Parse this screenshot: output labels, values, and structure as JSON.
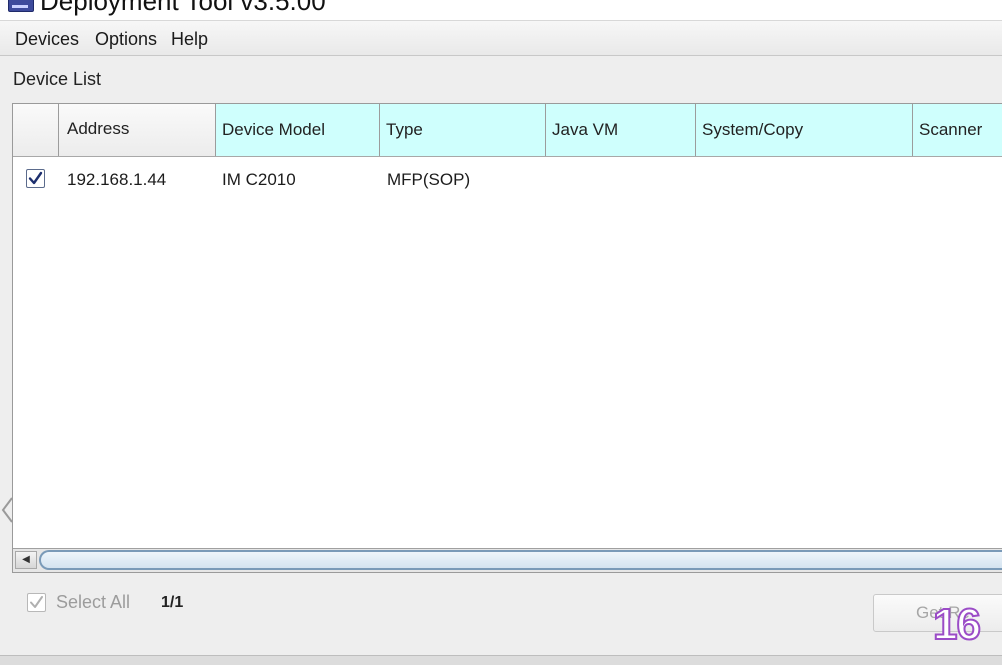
{
  "window": {
    "title": "Deployment Tool v3.5.00"
  },
  "menu": {
    "devices": "Devices",
    "options": "Options",
    "help": "Help"
  },
  "device_list": {
    "label": "Device List",
    "columns": [
      "Address",
      "Device Model",
      "Type",
      "Java VM",
      "System/Copy",
      "Scanner"
    ],
    "rows": [
      {
        "checked": true,
        "address": "192.168.1.44",
        "model": "IM C2010",
        "type": "MFP(SOP)",
        "java_vm": "",
        "system_copy": "",
        "scanner": ""
      }
    ]
  },
  "footer": {
    "select_all_label": "Select All",
    "select_all_checked": true,
    "page": "1/1",
    "get_button_label": "Get Re"
  },
  "overlay": {
    "badge_number": "16"
  },
  "colors": {
    "accent_header": "#cffffd",
    "badge_outline": "#9b4cc7"
  }
}
